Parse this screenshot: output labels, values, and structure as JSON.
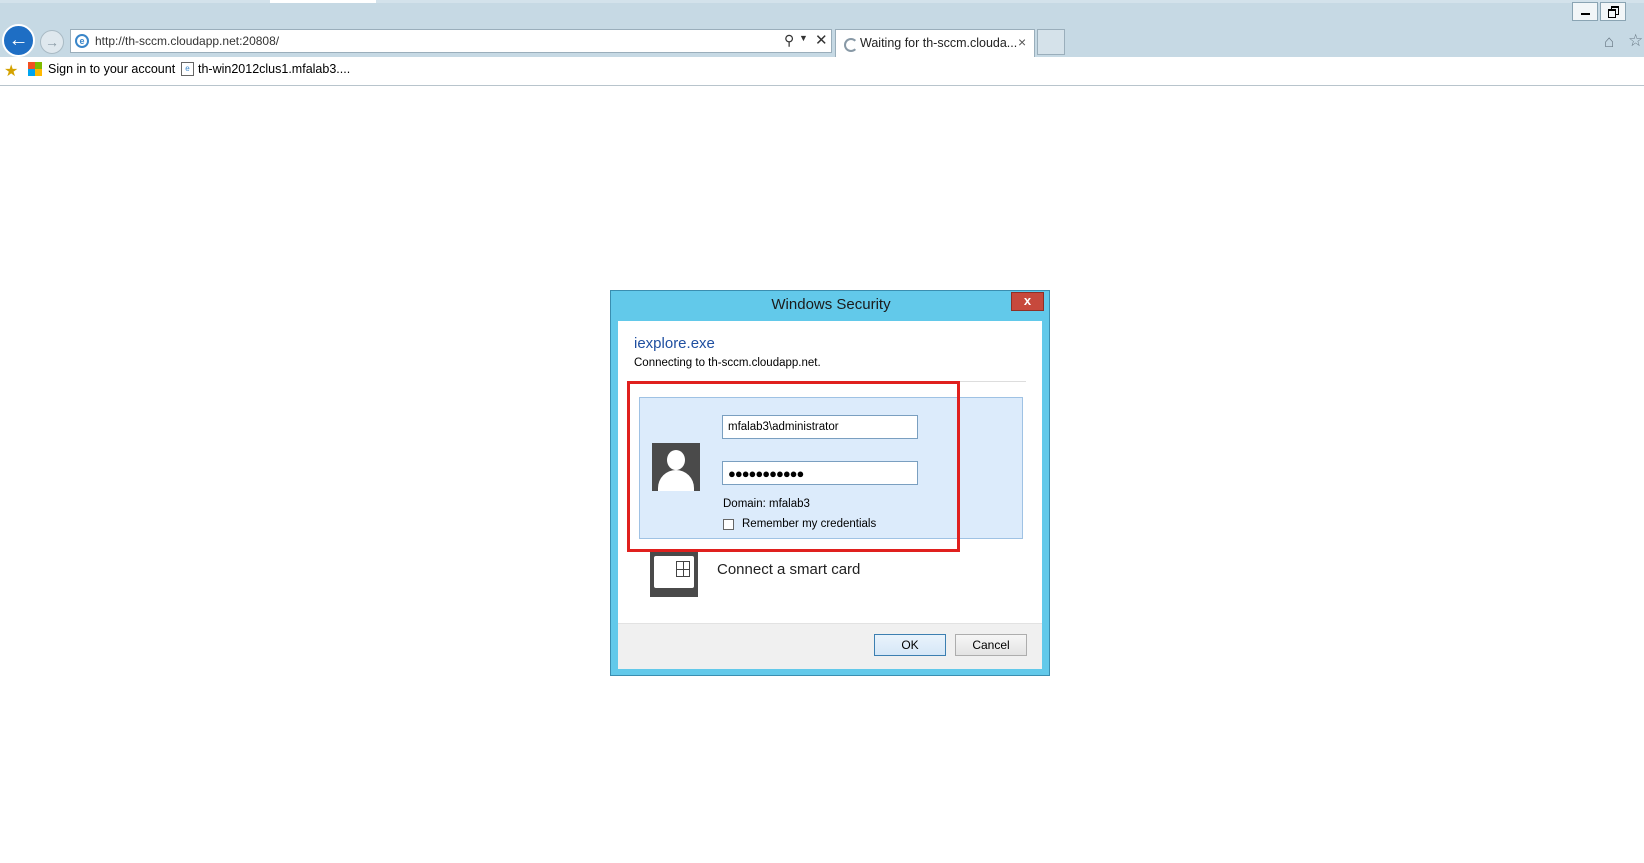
{
  "browser": {
    "address_url": "http://th-sccm.cloudapp.net:20808/",
    "tab_title": "Waiting for th-sccm.clouda...",
    "tab_close": "×",
    "favorites": [
      {
        "label": "Sign in to your account"
      },
      {
        "label": "th-win2012clus1.mfalab3...."
      }
    ]
  },
  "dialog": {
    "title": "Windows Security",
    "close_glyph": "x",
    "app_name": "iexplore.exe",
    "connecting_text": "Connecting to th-sccm.cloudapp.net.",
    "username_value": "mfalab3\\administrator",
    "password_value": "●●●●●●●●●●●",
    "domain_text": "Domain: mfalab3",
    "remember_label": "Remember my credentials",
    "remember_checked": false,
    "smartcard_label": "Connect a smart card",
    "ok_label": "OK",
    "cancel_label": "Cancel"
  },
  "colors": {
    "dialog_frame": "#62c9ea",
    "highlight": "#e0201e",
    "link_blue": "#1f4fa0"
  }
}
